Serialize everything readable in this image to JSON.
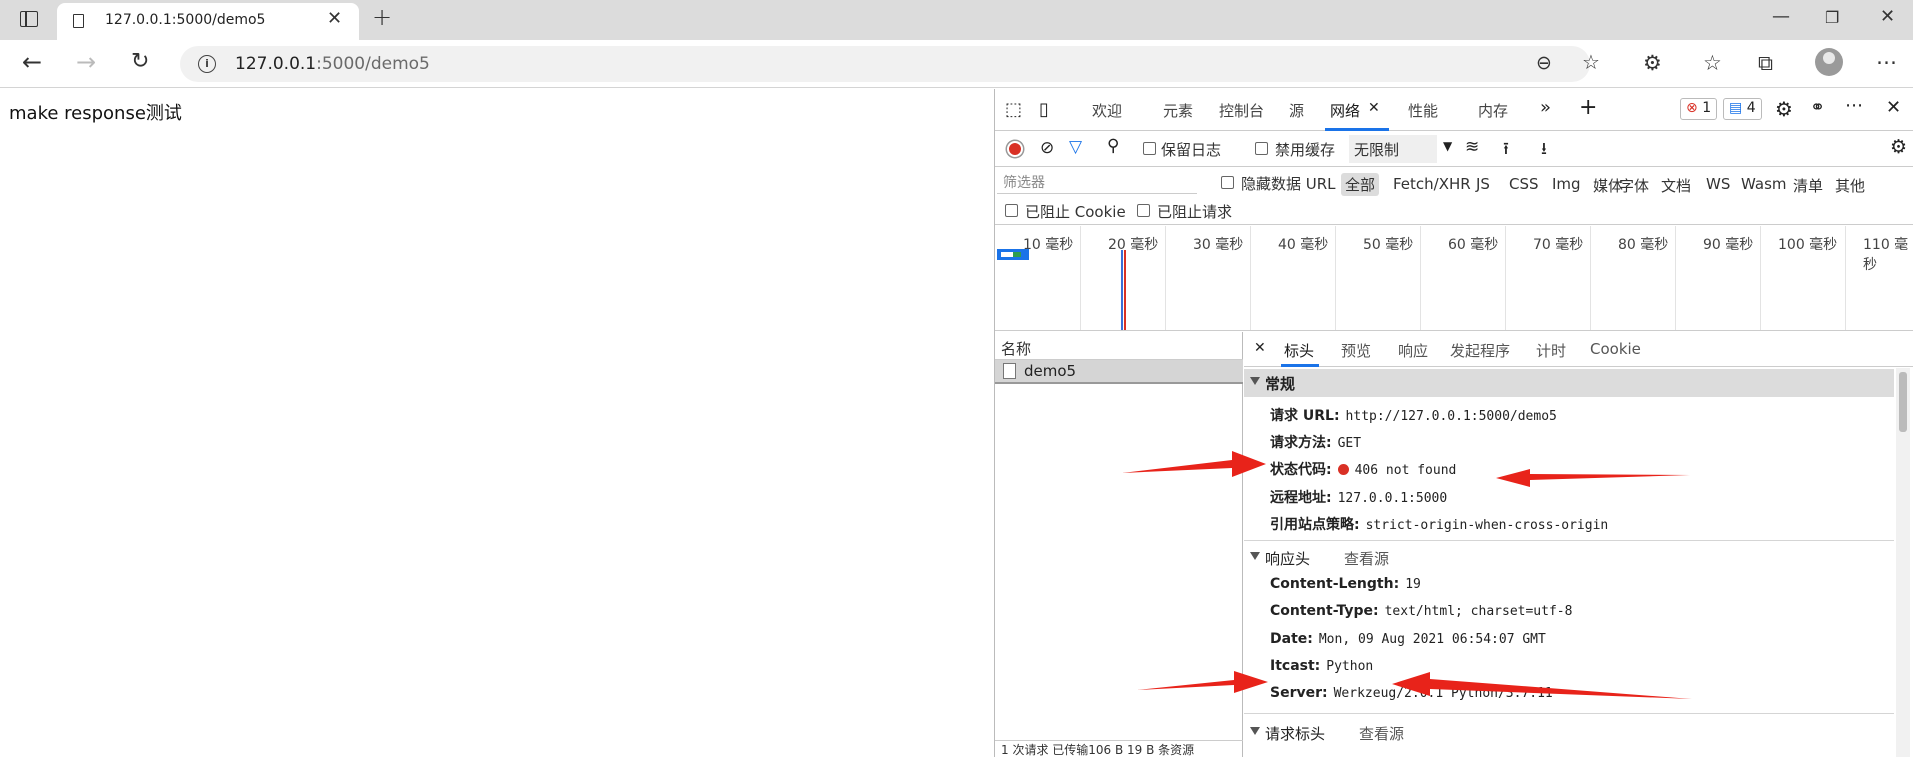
{
  "browser": {
    "tab_title": "127.0.0.1:5000/demo5",
    "url_host": "127.0.0.1",
    "url_rest": ":5000/demo5"
  },
  "page": {
    "message": "make response测试"
  },
  "devtools": {
    "tabs": [
      "欢迎",
      "元素",
      "控制台",
      "源",
      "网络",
      "性能",
      "内存"
    ],
    "active_tab": "网络",
    "error_count": "1",
    "message_count": "4",
    "toolbar": {
      "preserve_log": "保留日志",
      "disable_cache": "禁用缓存",
      "throttle": "无限制"
    },
    "filter": {
      "placeholder": "筛选器",
      "hide_data_url": "隐藏数据 URL",
      "types": [
        "全部",
        "Fetch/XHR",
        "JS",
        "CSS",
        "Img",
        "媒体",
        "字体",
        "文档",
        "WS",
        "Wasm",
        "清单",
        "其他"
      ],
      "blocked_cookies": "已阻止 Cookie",
      "blocked_requests": "已阻止请求"
    },
    "timeline": {
      "ticks": [
        "10 毫秒",
        "20 毫秒",
        "30 毫秒",
        "40 毫秒",
        "50 毫秒",
        "60 毫秒",
        "70 毫秒",
        "80 毫秒",
        "90 毫秒",
        "100 毫秒",
        "110 毫秒"
      ]
    },
    "requests": {
      "header": "名称",
      "items": [
        "demo5"
      ],
      "footer": "1 次请求 已传输106 B 19 B 条资源"
    },
    "detail": {
      "tabs": [
        "标头",
        "预览",
        "响应",
        "发起程序",
        "计时",
        "Cookie"
      ],
      "general": {
        "title": "常规",
        "request_url_k": "请求 URL:",
        "request_url_v": "http://127.0.0.1:5000/demo5",
        "method_k": "请求方法:",
        "method_v": "GET",
        "status_k": "状态代码:",
        "status_v": "406 not found",
        "remote_k": "远程地址:",
        "remote_v": "127.0.0.1:5000",
        "referrer_k": "引用站点策略:",
        "referrer_v": "strict-origin-when-cross-origin"
      },
      "response_headers": {
        "title": "响应头",
        "view_source": "查看源",
        "content_length_k": "Content-Length:",
        "content_length_v": "19",
        "content_type_k": "Content-Type:",
        "content_type_v": "text/html; charset=utf-8",
        "date_k": "Date:",
        "date_v": "Mon, 09 Aug 2021 06:54:07 GMT",
        "itcast_k": "Itcast:",
        "itcast_v": "Python",
        "server_k": "Server:",
        "server_v": "Werkzeug/2.0.1 Python/3.7.11"
      },
      "request_headers": {
        "title": "请求标头",
        "view_source": "查看源"
      }
    }
  },
  "colors": {
    "accent": "#1a73e8",
    "error_red": "#d93025",
    "annotation_red": "#e8231a"
  }
}
